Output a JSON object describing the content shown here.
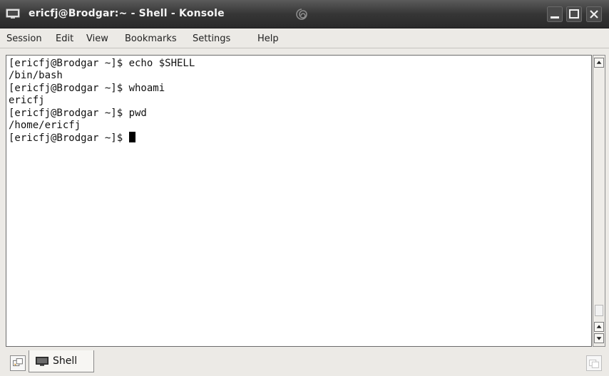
{
  "window": {
    "title": "ericfj@Brodgar:~ - Shell - Konsole",
    "icons": {
      "app": "monitor-icon",
      "title_decoration": "swirl-icon",
      "minimize": "minimize-icon",
      "maximize": "maximize-icon",
      "close": "close-icon"
    }
  },
  "menubar": {
    "items": [
      "Session",
      "Edit",
      "View",
      "Bookmarks",
      "Settings",
      "Help"
    ]
  },
  "terminal": {
    "lines": [
      "[ericfj@Brodgar ~]$ echo $SHELL",
      "/bin/bash",
      "[ericfj@Brodgar ~]$ whoami",
      "ericfj",
      "[ericfj@Brodgar ~]$ pwd",
      "/home/ericfj"
    ],
    "prompt": "[ericfj@Brodgar ~]$ "
  },
  "tabbar": {
    "tabs": [
      {
        "label": "Shell",
        "icon": "terminal-icon"
      }
    ],
    "new_tab_icon": "new-session-icon",
    "close_tab_icon": "close-session-icon"
  },
  "colors": {
    "titlebar": "#363636",
    "title_text": "#f4f4f4",
    "chrome": "#eceae6",
    "terminal_bg": "#ffffff",
    "terminal_fg": "#111111"
  }
}
